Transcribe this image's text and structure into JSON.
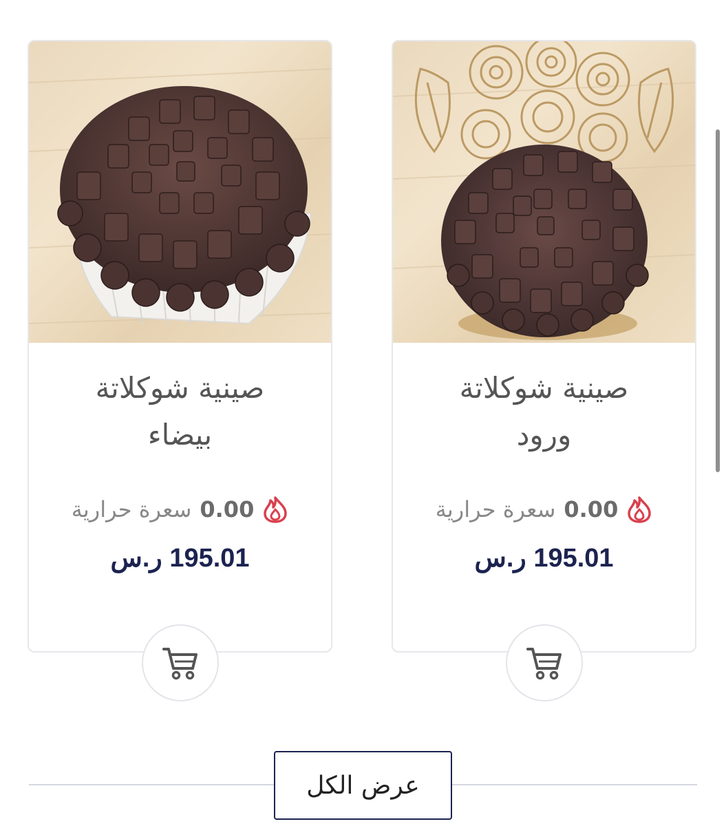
{
  "products": [
    {
      "title_line1": "صينية شوكلاتة",
      "title_line2": "بيضاء",
      "calories_value": "0.00",
      "calories_label": "سعرة حرارية",
      "price": "195.01 ر.س",
      "image_icon": "white-chocolate-tray-image",
      "cart_icon": "cart-icon"
    },
    {
      "title_line1": "صينية شوكلاتة",
      "title_line2": "ورود",
      "calories_value": "0.00",
      "calories_label": "سعرة حرارية",
      "price": "195.01 ر.س",
      "image_icon": "roses-chocolate-tray-image",
      "cart_icon": "cart-icon"
    }
  ],
  "view_all_label": "عرض الكل",
  "colors": {
    "price": "#1c2350",
    "fire_icon": "#d9404e",
    "border": "#e7e7ec",
    "view_all_border": "#1c2350"
  }
}
